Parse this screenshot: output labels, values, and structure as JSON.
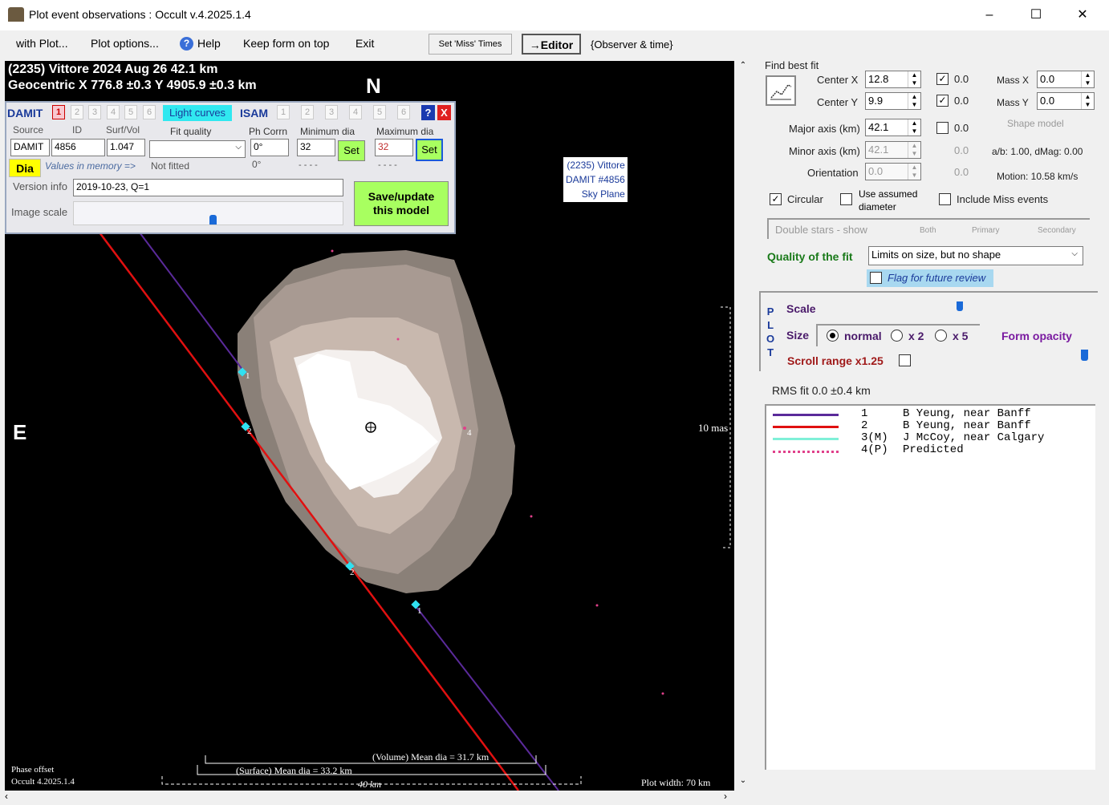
{
  "window": {
    "title": "Plot event observations : Occult v.4.2025.1.4",
    "minimize": "–",
    "maximize": "☐",
    "close": "✕"
  },
  "menu": {
    "with_plot": "with Plot...",
    "plot_options": "Plot options...",
    "help": "Help",
    "keep_on_top": "Keep form on top",
    "exit": "Exit",
    "set_miss": "Set 'Miss' Times",
    "editor": "→Editor",
    "observer_time": "{Observer & time}"
  },
  "plot": {
    "header1": "(2235) Vittore  2024 Aug 26  42.1 km",
    "header2": "Geocentric  X  776.8 ±0.3  Y 4905.9 ±0.3 km",
    "north": "N",
    "east": "E",
    "tag_lines": [
      "(2235) Vittore",
      "DAMIT #4856",
      "Sky Plane"
    ],
    "scale_mas": "10 mas",
    "volume_dia": "(Volume) Mean dia = 31.7 km",
    "surface_dia": "(Surface) Mean dia = 33.2 km",
    "scale_km": "40 km",
    "phase_offset": "Phase offset",
    "version": "Occult 4.2025.1.4",
    "plot_width": "Plot width: 70 km",
    "chord_labels": [
      "1",
      "2",
      "4",
      "2",
      "1"
    ]
  },
  "model": {
    "damit": "DAMIT",
    "damit_tabs": [
      "1",
      "2",
      "3",
      "4",
      "5",
      "6"
    ],
    "light_curves": "Light curves",
    "isam": "ISAM",
    "isam_tabs": [
      "1",
      "2",
      "3",
      "4",
      "5",
      "6"
    ],
    "help_btn": "?",
    "close_btn": "X",
    "source_lbl": "Source",
    "id_lbl": "ID",
    "surf_lbl": "Surf/Vol",
    "fit_lbl": "Fit quality",
    "phcorr_lbl": "Ph Corrn",
    "min_lbl": "Minimum dia",
    "max_lbl": "Maximum dia",
    "source": "DAMIT",
    "id": "4856",
    "surf": "1.047",
    "fit": "",
    "phcorr": "0°",
    "min": "32",
    "max": "32",
    "set": "Set",
    "dia": "Dia",
    "values_mem": "Values in memory =>",
    "not_fitted": "Not fitted",
    "phcorr_val": "0°",
    "dash1": "- - - -",
    "dash2": "- - - -",
    "version_lbl": "Version info",
    "version": "2019-10-23, Q=1",
    "image_scale": "Image scale",
    "save_line1": "Save/update",
    "save_line2": "this model"
  },
  "fit": {
    "find_best": "Find best fit",
    "center_x_lbl": "Center X",
    "center_x": "12.8",
    "center_y_lbl": "Center Y",
    "center_y": "9.9",
    "cx_fix": "0.0",
    "cy_fix": "0.0",
    "mass_x_lbl": "Mass X",
    "mass_x": "0.0",
    "mass_y_lbl": "Mass Y",
    "mass_y": "0.0",
    "major_lbl": "Major axis (km)",
    "major": "42.1",
    "major_fix": "0.0",
    "minor_lbl": "Minor axis (km)",
    "minor": "42.1",
    "minor_fix": "0.0",
    "orient_lbl": "Orientation",
    "orient": "0.0",
    "orient_fix": "0.0",
    "shape_model": "Shape model",
    "ab": "a/b: 1.00, dMag: 0.00",
    "motion": "Motion: 10.58 km/s",
    "circular": "Circular",
    "use_assumed1": "Use assumed",
    "use_assumed2": "diameter",
    "include_miss": "Include Miss events",
    "double_stars": "Double stars - show",
    "both": "Both",
    "primary": "Primary",
    "secondary": "Secondary",
    "quality_lbl": "Quality of the fit",
    "quality": "Limits on size, but no shape",
    "flag": "Flag for future review"
  },
  "plotctl": {
    "vlabel": [
      "P",
      "L",
      "O",
      "T"
    ],
    "scale": "Scale",
    "size": "Size",
    "normal": "normal",
    "x2": "x 2",
    "x5": "x 5",
    "form_opacity": "Form opacity",
    "scroll_range": "Scroll range x1.25",
    "rms": "RMS fit 0.0 ±0.4 km"
  },
  "legend": [
    {
      "num": "1",
      "name": "B Yeung, near Banff",
      "color": "#5a2a9a"
    },
    {
      "num": "2",
      "name": "B Yeung, near Banff",
      "color": "#e01010"
    },
    {
      "num": "3(M)",
      "name": "J McCoy, near Calgary",
      "color": "#7ff0d8"
    },
    {
      "num": "4(P)",
      "name": "Predicted",
      "color": "#e0408a"
    }
  ]
}
